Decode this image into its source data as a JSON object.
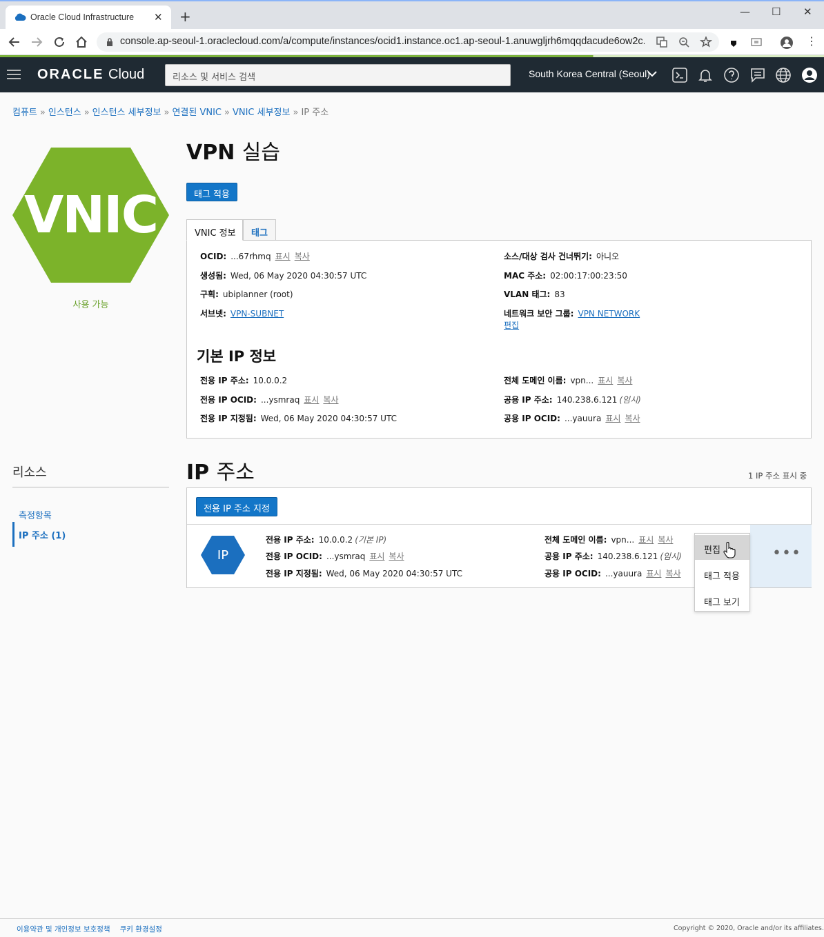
{
  "browser": {
    "tab_title": "Oracle Cloud Infrastructure",
    "url": "console.ap-seoul-1.oraclecloud.com/a/compute/instances/ocid1.instance.oc1.ap-seoul-1.anuwgljrh6mqqdacude6ow2c..."
  },
  "header": {
    "brand_bold": "ORACLE",
    "brand_light": "Cloud",
    "search_placeholder": "리소스 및 서비스 검색",
    "region": "South Korea Central (Seoul)",
    "icons": [
      "cloud-shell-icon",
      "bell-icon",
      "help-icon",
      "chat-icon",
      "globe-icon",
      "user-icon"
    ]
  },
  "breadcrumb": [
    {
      "label": "컴퓨트"
    },
    {
      "label": "인스턴스"
    },
    {
      "label": "인스턴스 세부정보"
    },
    {
      "label": "연결된 VNIC"
    },
    {
      "label": "VNIC 세부정보"
    }
  ],
  "breadcrumb_current": "IP 주소",
  "breadcrumb_sep": "»",
  "resource": {
    "badge": "VNIC",
    "status": "사용 가능",
    "badge_color": "#7cb32a",
    "status_color": "#6aa12b"
  },
  "page": {
    "title_main": "VPN",
    "title_rest": "실습",
    "apply_tag_button": "태그 적용",
    "tabs": [
      "VNIC 정보",
      "태그"
    ]
  },
  "vnic_info": {
    "ocid": {
      "label": "OCID:",
      "value": "...67rhmq",
      "show": "표시",
      "copy": "복사"
    },
    "created": {
      "label": "생성됨:",
      "value": "Wed, 06 May 2020 04:30:57 UTC"
    },
    "compartment": {
      "label": "구획:",
      "value": "ubiplanner (root)"
    },
    "subnet": {
      "label": "서브넷:",
      "value": "VPN-SUBNET"
    },
    "skip_check": {
      "label": "소스/대상 검사 건너뛰기:",
      "value": "아니오"
    },
    "mac": {
      "label": "MAC 주소:",
      "value": "02:00:17:00:23:50"
    },
    "vlan": {
      "label": "VLAN 태그:",
      "value": "83"
    },
    "nsg": {
      "label": "네트워크 보안 그룹:",
      "value": "VPN NETWORK",
      "edit": "편집"
    }
  },
  "primary_ip": {
    "title": "기본 IP 정보",
    "private_ip": {
      "label": "전용 IP 주소:",
      "value": "10.0.0.2"
    },
    "private_ocid": {
      "label": "전용 IP OCID:",
      "value": "...ysmraq",
      "show": "표시",
      "copy": "복사"
    },
    "assigned": {
      "label": "전용 IP 지정됨:",
      "value": "Wed, 06 May 2020 04:30:57 UTC"
    },
    "fqdn": {
      "label": "전체 도메인 이름:",
      "value": "vpn...",
      "show": "표시",
      "copy": "복사"
    },
    "public_ip": {
      "label": "공용 IP 주소:",
      "value": "140.238.6.121",
      "note": "(임시)"
    },
    "public_ocid": {
      "label": "공용 IP OCID:",
      "value": "...yauura",
      "show": "표시",
      "copy": "복사"
    }
  },
  "resources": {
    "title": "리소스",
    "items": [
      {
        "label": "측정항목"
      },
      {
        "label": "IP 주소 (1)"
      }
    ]
  },
  "ip_section": {
    "title_main": "IP",
    "title_rest": "주소",
    "count_text": "1 IP 주소 표시 중",
    "assign_button": "전용 IP 주소 지정",
    "row": {
      "icon_label": "IP",
      "icon_color": "#1b6fbf",
      "private_ip_label": "전용 IP 주소:",
      "private_ip_value": "10.0.0.2",
      "private_ip_note": "(기본 IP)",
      "private_ocid_label": "전용 IP OCID:",
      "private_ocid_value": "...ysmraq",
      "assigned_label": "전용 IP 지정됨:",
      "assigned_value": "Wed, 06 May 2020 04:30:57 UTC",
      "fqdn_label": "전체 도메인 이름:",
      "fqdn_value": "vpn...",
      "public_ip_label": "공용 IP 주소:",
      "public_ip_value": "140.238.6.121",
      "public_ip_note": "(임시)",
      "public_ocid_label": "공용 IP OCID:",
      "public_ocid_value": "...yauura",
      "show": "표시",
      "copy": "복사",
      "actions_icon": "•••"
    },
    "menu": [
      "편집",
      "태그 적용",
      "태그 보기"
    ]
  },
  "footer": {
    "terms": "이용약관 및 개인정보 보호정책",
    "cookies": "쿠키 환경설정",
    "copyright": "Copyright © 2020, Oracle and/or its affiliates."
  }
}
